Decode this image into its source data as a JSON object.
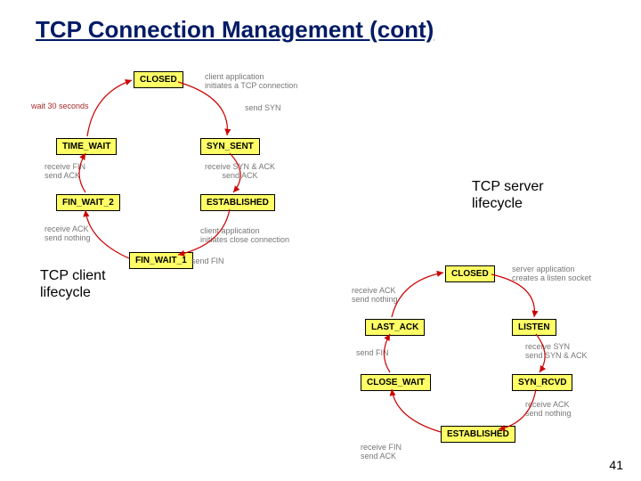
{
  "title": "TCP Connection Management (cont)",
  "captions": {
    "server": "TCP server\nlifecycle",
    "client": "TCP client\nlifecycle"
  },
  "page_number": "41",
  "client": {
    "states": {
      "closed": "CLOSED",
      "syn_sent": "SYN_SENT",
      "established": "ESTABLISHED",
      "fin_wait_1": "FIN_WAIT_1",
      "fin_wait_2": "FIN_WAIT_2",
      "time_wait": "TIME_WAIT"
    },
    "notes": {
      "init": "client application\ninitiates a TCP connection",
      "send_syn": "send SYN",
      "recv_synack": "receive SYN & ACK\nsend ACK",
      "close": "client application\ninitiates close connection",
      "send_fin": "send FIN",
      "recv_ack": "receive ACK\nsend nothing",
      "recv_fin": "receive FIN\nsend ACK",
      "wait30": "wait 30 seconds"
    }
  },
  "server": {
    "states": {
      "closed": "CLOSED",
      "listen": "LISTEN",
      "syn_rcvd": "SYN_RCVD",
      "established": "ESTABLISHED",
      "close_wait": "CLOSE_WAIT",
      "last_ack": "LAST_ACK"
    },
    "notes": {
      "create_socket": "server application\ncreates a listen socket",
      "recv_syn": "receive SYN\nsend SYN & ACK",
      "recv_ack": "receive ACK\nsend nothing",
      "recv_fin": "receive FIN\nsend ACK",
      "send_fin": "send FIN",
      "recv_ack2": "receive ACK\nsend nothing"
    }
  }
}
